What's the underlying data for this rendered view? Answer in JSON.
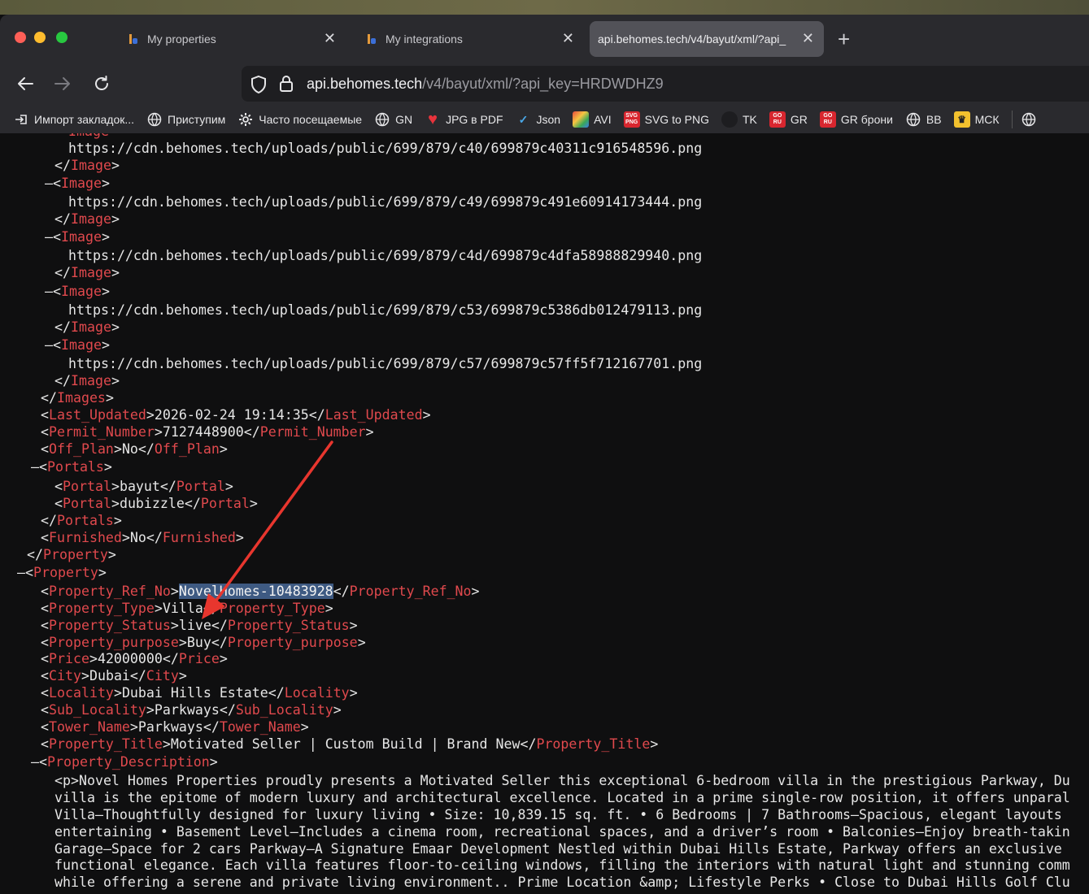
{
  "window": {
    "tabs": [
      {
        "label": "My properties",
        "close": "✕",
        "icon": "behomes-favicon"
      },
      {
        "label": "My integrations",
        "close": "✕",
        "icon": "behomes-favicon"
      },
      {
        "label": "api.behomes.tech/v4/bayut/xml/?api_",
        "close": "✕",
        "active": true
      }
    ],
    "new_tab": "+"
  },
  "navigation": {
    "url_host": "api.behomes.tech",
    "url_path": "/v4/bayut/xml/?api_key=HRDWDHZ9"
  },
  "bookmarks": [
    {
      "label": "Импорт закладок...",
      "icon": "import-icon"
    },
    {
      "label": "Приступим",
      "icon": "globe-icon"
    },
    {
      "label": "Часто посещаемые",
      "icon": "gear-icon"
    },
    {
      "label": "GN",
      "icon": "globe-icon"
    },
    {
      "label": "JPG в PDF",
      "icon": "heart-icon"
    },
    {
      "label": "Json",
      "icon": "check-icon"
    },
    {
      "label": "AVI",
      "icon": "avi-icon"
    },
    {
      "label": "SVG to PNG",
      "icon": "svg-icon"
    },
    {
      "label": "TK",
      "icon": "tk-icon"
    },
    {
      "label": "GR",
      "icon": "goru-icon"
    },
    {
      "label": "GR брони",
      "icon": "goru-icon"
    },
    {
      "label": "BB",
      "icon": "globe-icon"
    },
    {
      "label": "МСК",
      "icon": "crown-icon"
    }
  ],
  "xml": {
    "image_urls": [
      "https://cdn.behomes.tech/uploads/public/699/879/c40/699879c40311c916548596.png",
      "https://cdn.behomes.tech/uploads/public/699/879/c49/699879c491e60914173444.png",
      "https://cdn.behomes.tech/uploads/public/699/879/c4d/699879c4dfa58988829940.png",
      "https://cdn.behomes.tech/uploads/public/699/879/c53/699879c5386db012479113.png",
      "https://cdn.behomes.tech/uploads/public/699/879/c57/699879c57ff5f712167701.png"
    ],
    "image_tag": "Image",
    "images_tag": "Images",
    "last_updated": "2026-02-24 19:14:35",
    "permit_number": "7127448900",
    "off_plan": "No",
    "portals": [
      "bayut",
      "dubizzle"
    ],
    "furnished": "No",
    "property_ref_no": "NovelHomes-10483928",
    "property_type": "Villa",
    "property_status": "live",
    "property_purpose": "Buy",
    "price": "42000000",
    "city": "Dubai",
    "locality": "Dubai Hills Estate",
    "sub_locality": "Parkways",
    "tower_name": "Parkways",
    "property_title": "Motivated Seller | Custom Build | Brand New",
    "description_lines": [
      "<p>Novel Homes Properties proudly presents a Motivated Seller this exceptional 6-bedroom villa in the prestigious Parkway, Du",
      "villa is the epitome of modern luxury and architectural excellence. Located in a prime single-row position, it offers unparal",
      "Villa—Thoughtfully designed for luxury living • Size: 10,839.15 sq. ft. • 6 Bedrooms | 7 Bathrooms—Spacious, elegant layouts",
      "entertaining • Basement Level—Includes a cinema room, recreational spaces, and a driver’s room • Balconies—Enjoy breath-takin",
      "Garage—Space for 2 cars Parkway—A Signature Emaar Development Nestled within Dubai Hills Estate, Parkway offers an exclusive",
      "functional elegance. Each villa features floor-to-ceiling windows, filling the interiors with natural light and stunning comm",
      "while offering a serene and private living environment.. Prime Location &amp; Lifestyle Perks • Close to Dubai Hills Golf Clu"
    ]
  }
}
